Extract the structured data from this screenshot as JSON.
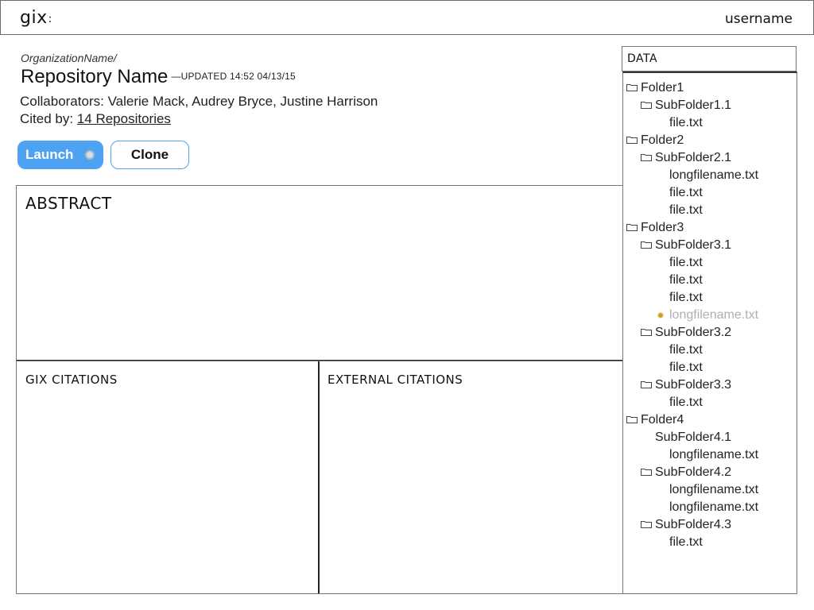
{
  "header": {
    "logo": "gix",
    "logo_suffix": ":",
    "username": "username"
  },
  "repo": {
    "organization": "OrganizationName/",
    "name": "Repository Name",
    "updated": "—UPDATED 14:52 04/13/15",
    "collaborators_label": "Collaborators: ",
    "collaborators": "Valerie Mack, Audrey Bryce, Justine Harrison",
    "cited_label": "Cited by: ",
    "cited_link": "14 Repositories"
  },
  "actions": {
    "launch": "Launch",
    "clone": "Clone"
  },
  "sections": {
    "abstract": "ABSTRACT",
    "gix_citations": "GIX CITATIONS",
    "external_citations": "EXTERNAL CITATIONS"
  },
  "data_panel": {
    "title": "DATA",
    "tree": [
      {
        "label": "Folder1",
        "level": 0,
        "icon": "folder-icon"
      },
      {
        "label": "SubFolder1.1",
        "level": 1,
        "icon": "folder-icon"
      },
      {
        "label": "file.txt",
        "level": 2
      },
      {
        "label": "Folder2",
        "level": 0,
        "icon": "folder-icon"
      },
      {
        "label": "SubFolder2.1",
        "level": 1,
        "icon": "folder-icon"
      },
      {
        "label": "longfilename.txt",
        "level": 2
      },
      {
        "label": "file.txt",
        "level": 2
      },
      {
        "label": "file.txt",
        "level": 2
      },
      {
        "label": "Folder3",
        "level": 0,
        "icon": "folder-icon"
      },
      {
        "label": "SubFolder3.1",
        "level": 1,
        "icon": "folder-icon"
      },
      {
        "label": "file.txt",
        "level": 2
      },
      {
        "label": "file.txt",
        "level": 2
      },
      {
        "label": "file.txt",
        "level": 2
      },
      {
        "label": "longfilename.txt",
        "level": 2,
        "state": "loading"
      },
      {
        "label": "SubFolder3.2",
        "level": 1,
        "icon": "folder-icon"
      },
      {
        "label": "file.txt",
        "level": 2
      },
      {
        "label": "file.txt",
        "level": 2
      },
      {
        "label": "SubFolder3.3",
        "level": 1,
        "icon": "folder-icon"
      },
      {
        "label": "file.txt",
        "level": 2
      },
      {
        "label": "Folder4",
        "level": 0,
        "icon": "folder-icon"
      },
      {
        "label": "SubFolder4.1",
        "level": 1
      },
      {
        "label": "longfilename.txt",
        "level": 2
      },
      {
        "label": "SubFolder4.2",
        "level": 1,
        "icon": "folder-icon"
      },
      {
        "label": "longfilename.txt",
        "level": 2
      },
      {
        "label": "longfilename.txt",
        "level": 2
      },
      {
        "label": "SubFolder4.3",
        "level": 1,
        "icon": "folder-icon"
      },
      {
        "label": "file.txt",
        "level": 2
      }
    ]
  }
}
